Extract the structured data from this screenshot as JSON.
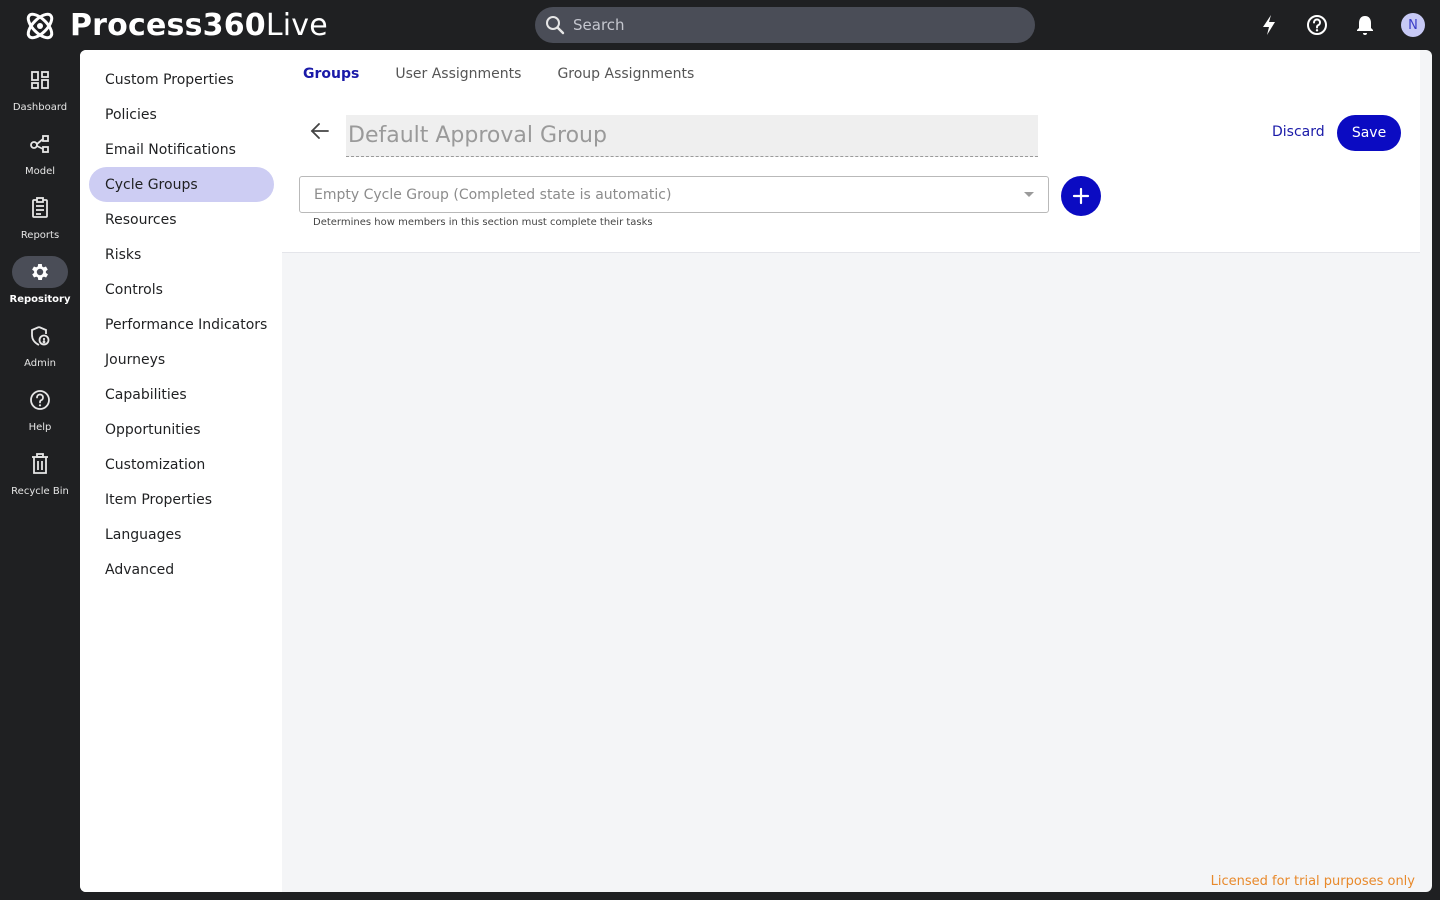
{
  "brand": {
    "name_bold": "Process360",
    "name_light": "Live"
  },
  "search": {
    "placeholder": "Search"
  },
  "user": {
    "initial": "N"
  },
  "rail": [
    {
      "label": "Dashboard",
      "icon": "dashboard-icon"
    },
    {
      "label": "Model",
      "icon": "model-icon"
    },
    {
      "label": "Reports",
      "icon": "reports-icon"
    },
    {
      "label": "Repository",
      "icon": "gear-icon",
      "active": true
    },
    {
      "label": "Admin",
      "icon": "admin-shield-icon"
    },
    {
      "label": "Help",
      "icon": "help-icon"
    },
    {
      "label": "Recycle Bin",
      "icon": "trash-icon"
    }
  ],
  "subnav": [
    "Custom Properties",
    "Policies",
    "Email Notifications",
    "Cycle Groups",
    "Resources",
    "Risks",
    "Controls",
    "Performance Indicators",
    "Journeys",
    "Capabilities",
    "Opportunities",
    "Customization",
    "Item Properties",
    "Languages",
    "Advanced"
  ],
  "subnav_active": "Cycle Groups",
  "tabs": [
    "Groups",
    "User Assignments",
    "Group Assignments"
  ],
  "tab_active": "Groups",
  "editor": {
    "name_placeholder": "Default Approval Group",
    "discard_label": "Discard",
    "save_label": "Save",
    "select_value": "Empty Cycle Group (Completed state is automatic)",
    "hint": "Determines how members in this section must complete their tasks"
  },
  "license": "Licensed for trial purposes only",
  "colors": {
    "accent": "#0b0bc2",
    "active_nav": "#cdcdf3",
    "license": "#e8892b",
    "topbar": "#1f2022"
  }
}
